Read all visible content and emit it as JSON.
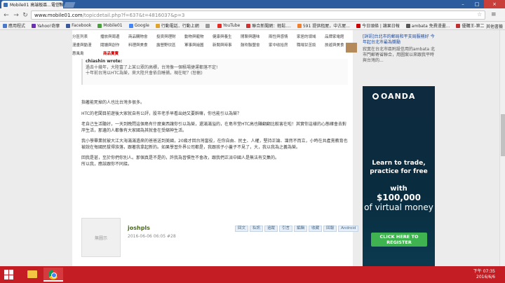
{
  "browser": {
    "tab_title": "Mobile01 高端板區...電信聯通...",
    "url_host": "www.mobile01.com",
    "url_path": "/topicdetail.php?f=637&t=4816037&p=3",
    "bookmarks": [
      {
        "label": "應用程式",
        "color": "#4a79c9"
      },
      {
        "label": "Yahoo!奇摩",
        "color": "#6b2fb3"
      },
      {
        "label": "Facebook",
        "color": "#3b5998"
      },
      {
        "label": "Mobile01",
        "color": "#4aa03c"
      },
      {
        "label": "Google",
        "color": "#4285f4"
      },
      {
        "label": "行動電話．行動上網",
        "color": "#e0a42c"
      },
      {
        "label": "",
        "color": "#999999"
      },
      {
        "label": "YouTube",
        "color": "#e52d27"
      },
      {
        "label": "聯合新聞網：輕鬆....",
        "color": "#c33"
      },
      {
        "label": "591 提供租屋，中古屋...",
        "color": "#f08030"
      },
      {
        "label": "今日頭條 | 讓果日報",
        "color": "#c00"
      },
      {
        "label": "ambata 免費漫畫...",
        "color": "#555555"
      },
      {
        "label": "優購王-第二代優購...",
        "color": "#c03030"
      }
    ],
    "bookmarks_more": "其他書籤"
  },
  "forum_nav": [
    [
      "分區列表",
      "播放與周邊",
      "商品購物會",
      "投資與理財",
      "動物與寵物",
      "健康與養生",
      "閒聊與趣味",
      "兩性與感情",
      "家居的領域",
      "品牌家電館"
    ],
    [
      "漫畫與動漫",
      "閱讀與創作",
      "料理與美食",
      "露營野炊區",
      "軍事與繪圖",
      "新聞與時事",
      "鼓吹聯盟會",
      "家中收拾房",
      "職場甘苦談",
      "旅遊與美食"
    ],
    [
      "惠風島",
      "商品賣賣"
    ]
  ],
  "quote": {
    "author": "chiashin wrote:",
    "lines": [
      "過去十幾年，大陸富了上某公眾的高標，台灣像一個積場捷運都落不定!",
      "十年前台灣以HTC為榮，來大陸只會依白睡捕，現在呢？(恕刪)"
    ]
  },
  "post_paragraphs": [
    "指著能死掉的人也比台灣多很多。",
    "HTC的老闆目前遊後大家就自有公評，股市老手早看出她又要幹嘛，你也能引以為榮？",
    "老自己生活聽好，一天到晚問這個島有什麼東西讓你引以為榮，還滿滿溢的，在島市堂HTC高也賺翻翻比較害在啦！其實你這樣的心態確會去對岸生活，那邊的人都像有大家國為其就會在受縮神生活。",
    "我小學畢業就被大江大海滿滿過來的爸爸送到美國，20幾才回台灣當役，在你自由、民主、人權，堅持正論、凜然不而立，小時在共產黨教育也被說在每國民拔得族落，跟著我拿起新的。如果學習外界公司都是，我跟孩子小蓋子不見了，大，我以我為之義為榮。",
    "回我是甚，至於你們你別人。那個真是不是的，許我為習慣性不會改，跟我們正派中國人是無法有交集的。",
    "所以我，應該跟你不同接。"
  ],
  "reply": {
    "avatar_text": "無圖示",
    "username": "joshpls",
    "meta": "2016-06-06 06:05  #28",
    "actions": [
      "回文",
      "私訊",
      "追蹤",
      "引言",
      "編輯",
      "收藏",
      "回報",
      "Android"
    ]
  },
  "side": {
    "link": "[詳訊]台北市的郵局和平支局服務好 今年起台北市最為獎勵",
    "desc": "寂寞在台北市區附設信用的ambata 北市門郵寄省聯合，用圖案以來跟我平時與台灣的..."
  },
  "ad": {
    "brand": "OANDA",
    "headline": "Learn to trade, practice for free",
    "with": "with",
    "amount": "$100,000",
    "money_text": "of virtual money",
    "cta": "CLICK HERE TO REGISTER"
  },
  "taskbar": {
    "clock_time": "下午 07:35",
    "clock_date": "2016/6/6"
  }
}
